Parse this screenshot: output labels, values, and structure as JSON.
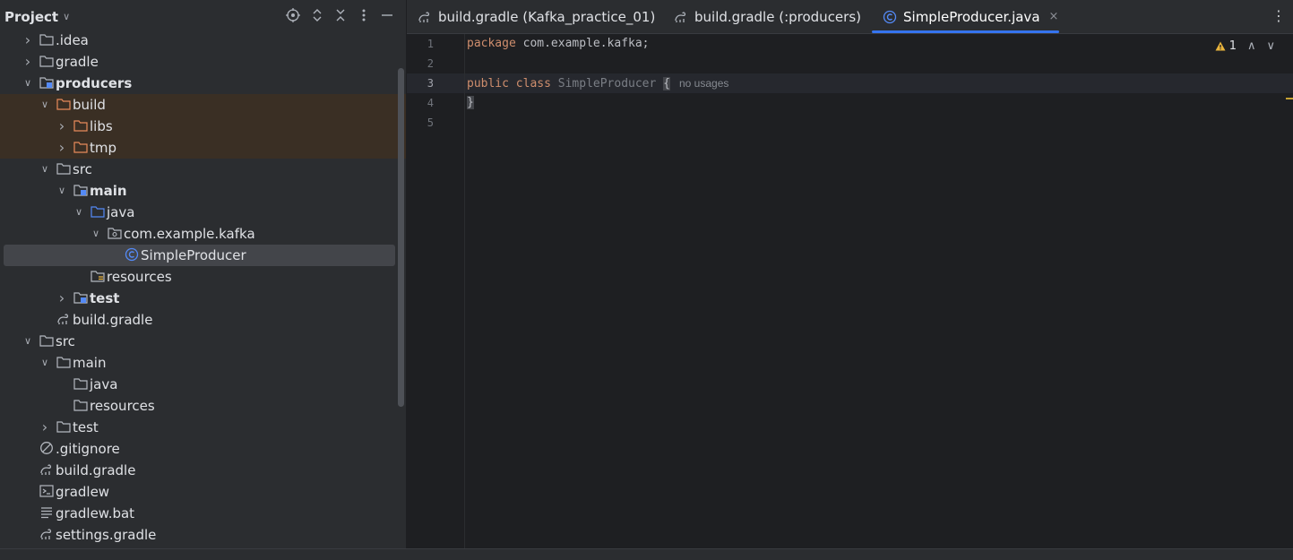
{
  "project_panel": {
    "title": "Project",
    "header_icons": [
      "locate-icon",
      "expand-all-icon",
      "collapse-all-icon",
      "more-options-icon",
      "hide-icon"
    ]
  },
  "tree": [
    {
      "label": ".idea",
      "depth": 0,
      "arrow": "collapsed",
      "icon": "folder"
    },
    {
      "label": "gradle",
      "depth": 0,
      "arrow": "collapsed",
      "icon": "folder"
    },
    {
      "label": "producers",
      "depth": 0,
      "arrow": "expanded",
      "icon": "module-folder",
      "bold": true
    },
    {
      "label": "build",
      "depth": 1,
      "arrow": "expanded",
      "icon": "excluded-folder",
      "excluded": true
    },
    {
      "label": "libs",
      "depth": 2,
      "arrow": "collapsed",
      "icon": "excluded-folder",
      "excluded": true
    },
    {
      "label": "tmp",
      "depth": 2,
      "arrow": "collapsed",
      "icon": "excluded-folder",
      "excluded": true
    },
    {
      "label": "src",
      "depth": 1,
      "arrow": "expanded",
      "icon": "folder"
    },
    {
      "label": "main",
      "depth": 2,
      "arrow": "expanded",
      "icon": "module-folder",
      "bold": true
    },
    {
      "label": "java",
      "depth": 3,
      "arrow": "expanded",
      "icon": "source-folder"
    },
    {
      "label": "com.example.kafka",
      "depth": 4,
      "arrow": "expanded",
      "icon": "package"
    },
    {
      "label": "SimpleProducer",
      "depth": 5,
      "arrow": "none",
      "icon": "class",
      "selected": true
    },
    {
      "label": "resources",
      "depth": 3,
      "arrow": "none",
      "icon": "resources-folder"
    },
    {
      "label": "test",
      "depth": 2,
      "arrow": "collapsed",
      "icon": "module-folder",
      "bold": true
    },
    {
      "label": "build.gradle",
      "depth": 1,
      "arrow": "none",
      "icon": "gradle"
    },
    {
      "label": "src",
      "depth": 0,
      "arrow": "expanded",
      "icon": "folder"
    },
    {
      "label": "main",
      "depth": 1,
      "arrow": "expanded",
      "icon": "folder"
    },
    {
      "label": "java",
      "depth": 2,
      "arrow": "none",
      "icon": "folder"
    },
    {
      "label": "resources",
      "depth": 2,
      "arrow": "none",
      "icon": "folder"
    },
    {
      "label": "test",
      "depth": 1,
      "arrow": "collapsed",
      "icon": "folder"
    },
    {
      "label": ".gitignore",
      "depth": 0,
      "arrow": "none",
      "icon": "ignore"
    },
    {
      "label": "build.gradle",
      "depth": 0,
      "arrow": "none",
      "icon": "gradle"
    },
    {
      "label": "gradlew",
      "depth": 0,
      "arrow": "none",
      "icon": "terminal"
    },
    {
      "label": "gradlew.bat",
      "depth": 0,
      "arrow": "none",
      "icon": "text-file"
    },
    {
      "label": "settings.gradle",
      "depth": 0,
      "arrow": "none",
      "icon": "gradle"
    }
  ],
  "tabs": [
    {
      "label": "build.gradle (Kafka_practice_01)",
      "icon": "gradle",
      "active": false
    },
    {
      "label": "build.gradle (:producers)",
      "icon": "gradle",
      "active": false
    },
    {
      "label": "SimpleProducer.java",
      "icon": "class",
      "active": true,
      "close": "×"
    }
  ],
  "editor": {
    "line_numbers": [
      "1",
      "2",
      "3",
      "4",
      "5"
    ],
    "current_line": "3",
    "code": {
      "line1_kw": "package",
      "line1_rest": " com.example.kafka;",
      "line3_kw1": "public",
      "line3_kw2": "class",
      "line3_name": "SimpleProducer",
      "line3_brace": "{",
      "line3_hint": "no usages",
      "line4": "}"
    },
    "inspection": {
      "warning_count": "1",
      "icon": "warning-icon"
    }
  },
  "colors": {
    "keyword": "#cf8e6d",
    "class_name": "#7a7e85",
    "accent": "#3574f0",
    "excluded_bg": "#3a2f24",
    "warning": "#e9b43c"
  }
}
